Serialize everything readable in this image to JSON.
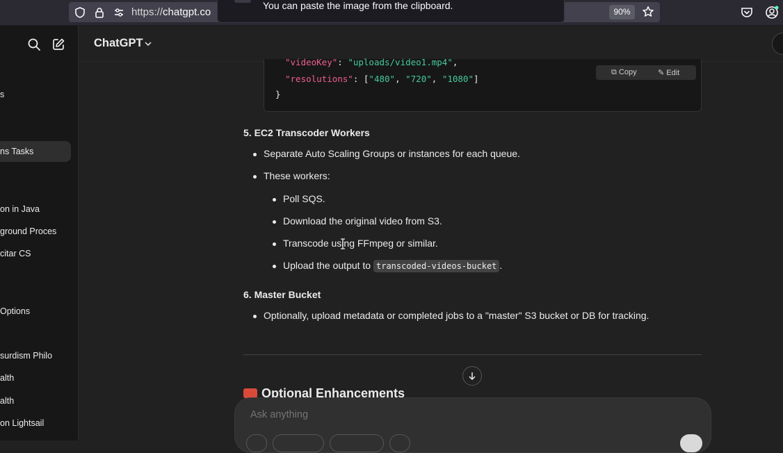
{
  "browser": {
    "url_prefix": "https://",
    "url_host": "chatgpt.co",
    "zoom": "90%",
    "toast_text": "You can paste the image from the clipboard."
  },
  "sidebar": {
    "items": [
      {
        "label": "s"
      },
      {
        "label": "ns Tasks"
      },
      {
        "label": "on in Java"
      },
      {
        "label": "ground Proces"
      },
      {
        "label": "citar CS"
      },
      {
        "label": "Options"
      },
      {
        "label": "surdism Philo"
      },
      {
        "label": "alth"
      },
      {
        "label": "alth"
      },
      {
        "label": "on Lightsail"
      }
    ]
  },
  "header": {
    "model": "ChatGPT"
  },
  "code": {
    "line1_key": "\"videoKey\"",
    "line1_val": "\"uploads/video1.mp4\"",
    "line2_key": "\"resolutions\"",
    "line2_vals": [
      "\"480\"",
      "\"720\"",
      "\"1080\""
    ],
    "closing": "}",
    "copy_label": "Copy",
    "edit_label": "Edit"
  },
  "content": {
    "section5_title": "5. EC2 Transcoder Workers",
    "s5_bullet1": "Separate Auto Scaling Groups or instances for each queue.",
    "s5_bullet2": "These workers:",
    "s5_sub": [
      "Poll SQS.",
      "Download the original video from S3.",
      "Transcode using FFmpeg or similar.",
      "Upload the output to"
    ],
    "s5_sub4_code": "transcoded-videos-bucket",
    "section6_title": "6. Master Bucket",
    "s6_bullet1": "Optionally, upload metadata or completed jobs to a \"master\" S3 bucket or DB for tracking.",
    "optional_title": "Optional Enhancements"
  },
  "composer": {
    "placeholder": "Ask anything"
  }
}
